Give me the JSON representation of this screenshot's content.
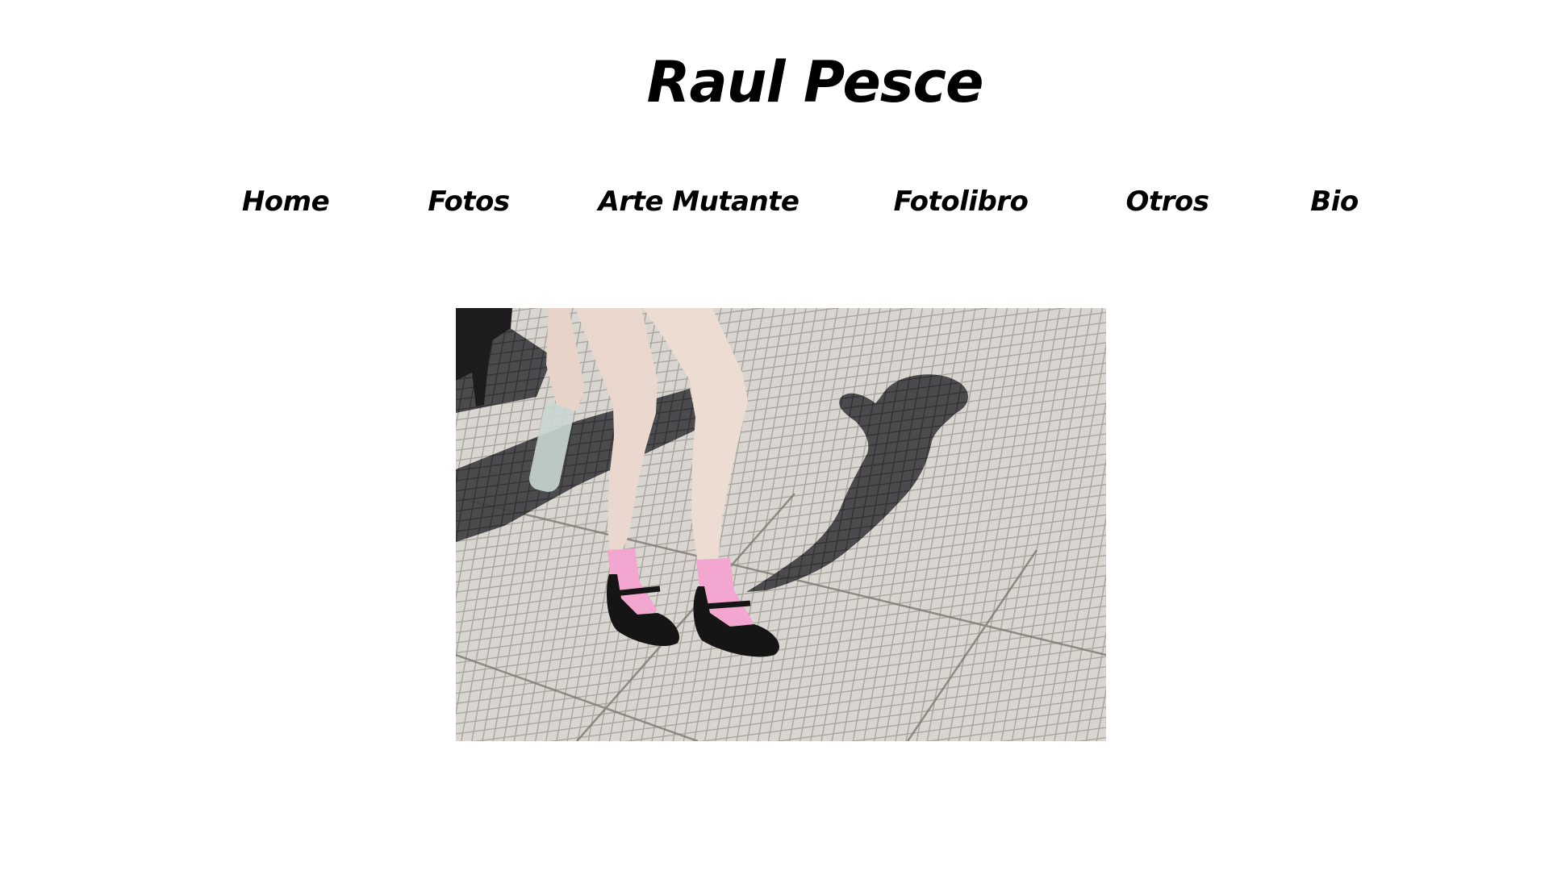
{
  "site": {
    "title": "Raul Pesce"
  },
  "nav": {
    "items": [
      {
        "label": "Home"
      },
      {
        "label": "Fotos"
      },
      {
        "label": "Arte Mutante"
      },
      {
        "label": "Fotolibro"
      },
      {
        "label": "Otros"
      },
      {
        "label": "Bio"
      }
    ]
  },
  "photo": {
    "icon": "photograph-legs-pink-socks-shadow",
    "colors": {
      "tile": "#d9d6d2",
      "grout": "#9a948c",
      "shadow": "#3a3a3d",
      "skin": "#e9d8cf",
      "sock": "#f2a6d0",
      "shoe": "#151515"
    }
  }
}
